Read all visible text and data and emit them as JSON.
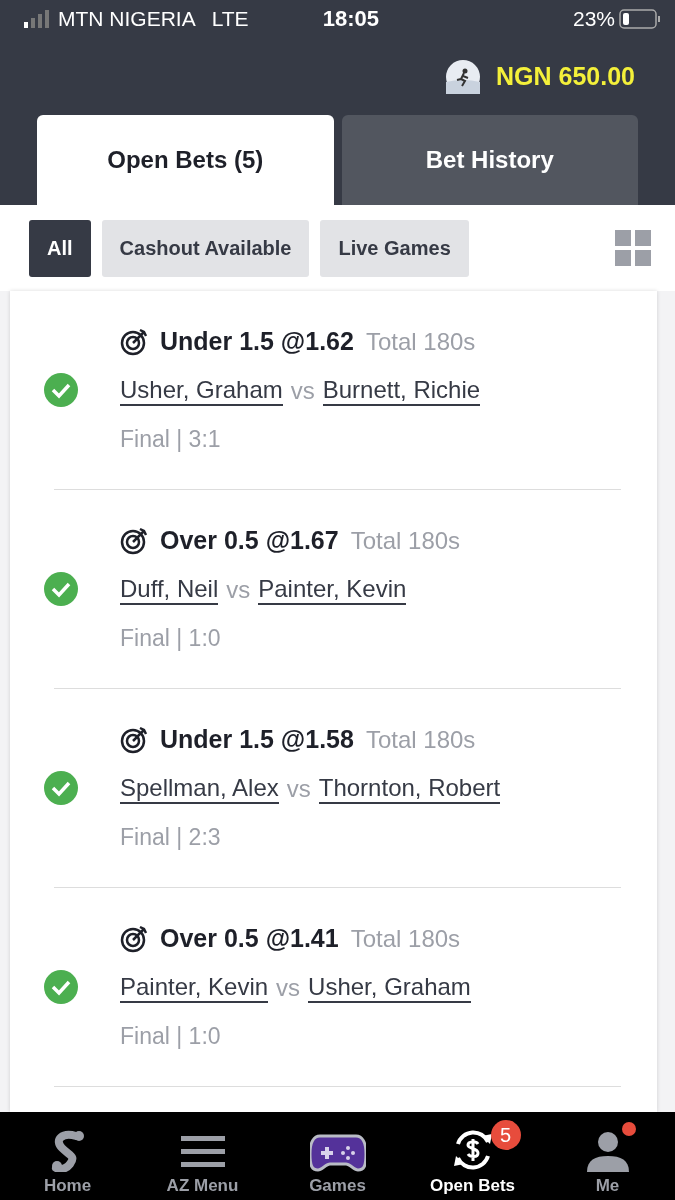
{
  "status_bar": {
    "carrier": "MTN NIGERIA",
    "network": "LTE",
    "time": "18:05",
    "battery": "23%"
  },
  "balance": "NGN 650.00",
  "tabs": [
    {
      "label": "Open Bets (5)",
      "selected": true
    },
    {
      "label": "Bet History",
      "selected": false
    }
  ],
  "filters": [
    {
      "label": "All",
      "selected": true
    },
    {
      "label": "Cashout Available",
      "selected": false
    },
    {
      "label": "Live Games",
      "selected": false
    }
  ],
  "bets": [
    {
      "market": "Under 1.5 @1.62",
      "type": "Total 180s",
      "home": "Usher, Graham",
      "vs": "vs",
      "away": "Burnett, Richie",
      "result": "Final | 3:1",
      "won": true
    },
    {
      "market": "Over 0.5 @1.67",
      "type": "Total 180s",
      "home": "Duff, Neil",
      "vs": "vs",
      "away": "Painter, Kevin",
      "result": "Final | 1:0",
      "won": true
    },
    {
      "market": "Under 1.5 @1.58",
      "type": "Total 180s",
      "home": "Spellman, Alex",
      "vs": "vs",
      "away": "Thornton, Robert",
      "result": "Final | 2:3",
      "won": true
    },
    {
      "market": "Over 0.5 @1.41",
      "type": "Total 180s",
      "home": "Painter, Kevin",
      "vs": "vs",
      "away": "Usher, Graham",
      "result": "Final | 1:0",
      "won": true
    }
  ],
  "nav": [
    {
      "kind": "home",
      "label": "Home",
      "selected": false
    },
    {
      "kind": "menu",
      "label": "AZ Menu",
      "selected": false
    },
    {
      "kind": "games",
      "label": "Games",
      "selected": false
    },
    {
      "kind": "bets",
      "label": "Open Bets",
      "selected": true,
      "badge": "5"
    },
    {
      "kind": "me",
      "label": "Me",
      "selected": false,
      "dot": true
    }
  ]
}
